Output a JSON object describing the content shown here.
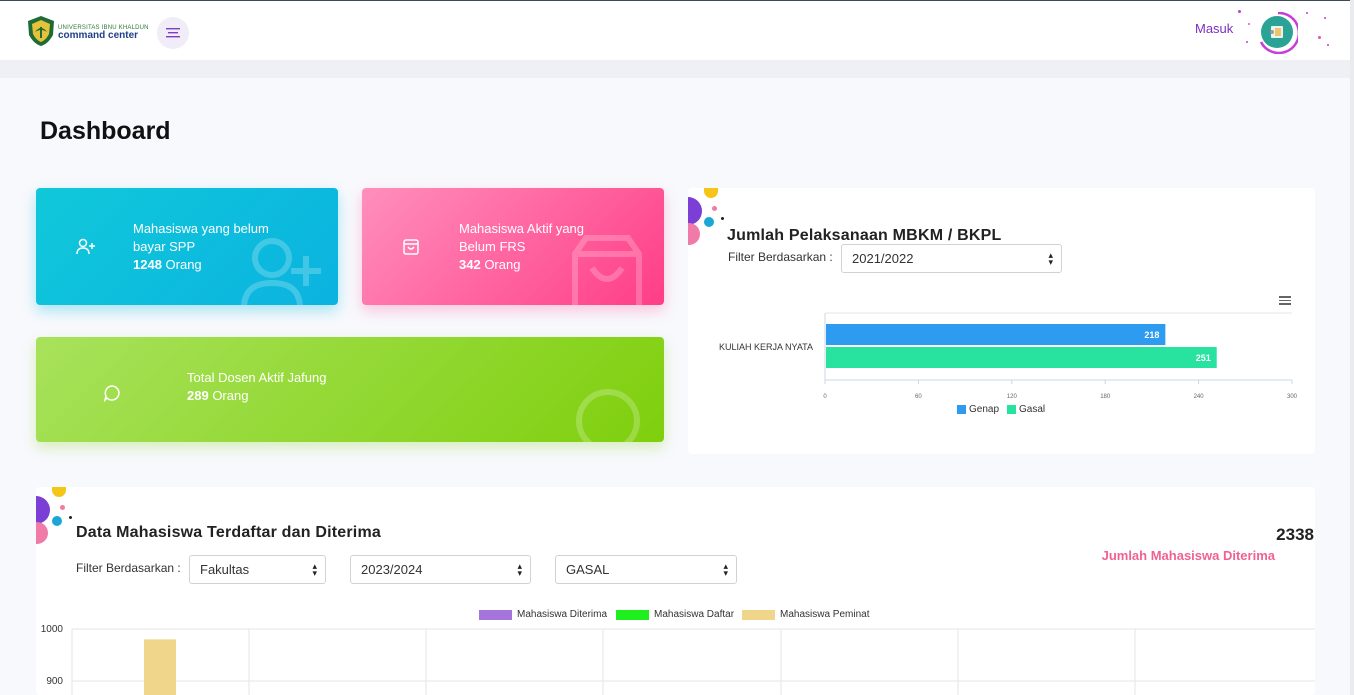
{
  "header": {
    "logo_line1": "UNIVERSITAS IBNU KHALDUN",
    "logo_line2": "command center",
    "login_label": "Masuk"
  },
  "page": {
    "title": "Dashboard"
  },
  "cards": [
    {
      "line1": "Mahasiswa yang belum",
      "line2": "bayar SPP",
      "count": "1248",
      "unit": " Orang",
      "icon": "user-plus-icon"
    },
    {
      "line1": "Mahasiswa Aktif yang",
      "line2": "Belum FRS",
      "count": "342",
      "unit": " Orang",
      "icon": "shopping-bag-icon"
    },
    {
      "line1": "Total Dosen Aktif Jafung",
      "count": "289",
      "unit": " Orang",
      "icon": "chat-bubble-icon"
    }
  ],
  "mbkm": {
    "title": "Jumlah Pelaksanaan MBKM / BKPL",
    "filter_label": "Filter Berdasarkan :",
    "year_value": "2021/2022"
  },
  "registrants": {
    "title": "Data Mahasiswa Terdaftar dan Diterima",
    "filter_label": "Filter Berdasarkan :",
    "faculty_value": "Fakultas",
    "year_value": "2023/2024",
    "semester_value": "GASAL",
    "total_value": "2338",
    "total_label": "Jumlah Mahasiswa Diterima"
  },
  "chart_data": [
    {
      "type": "bar",
      "orientation": "horizontal",
      "categories": [
        "KULIAH KERJA NYATA"
      ],
      "series": [
        {
          "name": "Genap",
          "values": [
            218
          ],
          "color": "#2d9cf0"
        },
        {
          "name": "Gasal",
          "values": [
            251
          ],
          "color": "#28e3a0"
        }
      ],
      "x_ticks": [
        "0",
        "60",
        "120",
        "180",
        "240",
        "300"
      ],
      "xlim": [
        0,
        300
      ],
      "legend_position": "bottom",
      "data_labels": true
    },
    {
      "type": "bar",
      "series": [
        {
          "name": "Mahasiswa Diterima",
          "color": "#a575dc"
        },
        {
          "name": "Mahasiswa Daftar",
          "color": "#1ef01e"
        },
        {
          "name": "Mahasiswa Peminat",
          "color": "#f0d68a",
          "values": [
            980
          ]
        }
      ],
      "y_ticks": [
        "1000",
        "900"
      ],
      "ylim_visible": [
        890,
        1000
      ],
      "legend_position": "top",
      "grid": true
    }
  ]
}
